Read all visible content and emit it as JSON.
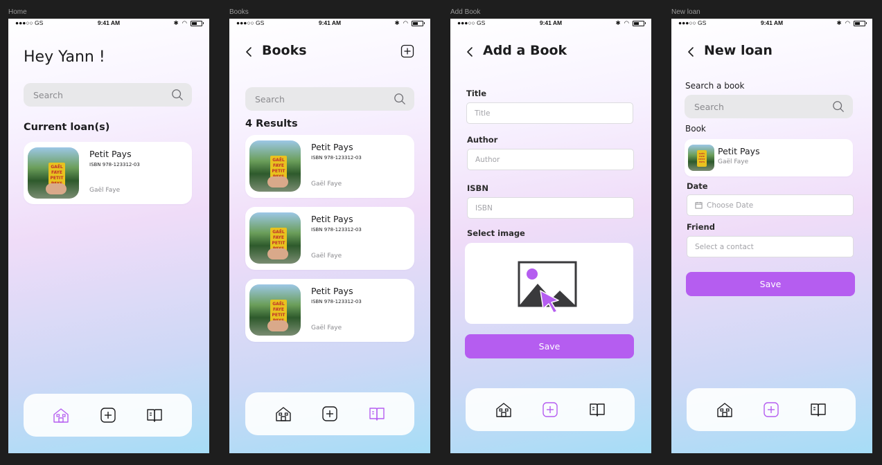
{
  "frames": [
    "Home",
    "Books",
    "Add Book",
    "New loan"
  ],
  "status": {
    "carrier": "●●●○○ GS",
    "time": "9:41 AM"
  },
  "home": {
    "greeting": "Hey Yann !",
    "search_placeholder": "Search",
    "section": "Current loan(s)",
    "loan": {
      "title": "Petit Pays",
      "isbn": "ISBN 978-123312-03",
      "author": "Gaël Faye"
    }
  },
  "books": {
    "title": "Books",
    "search_placeholder": "Search",
    "results": "4 Results",
    "items": [
      {
        "title": "Petit Pays",
        "isbn": "ISBN 978-123312-03",
        "author": "Gaël Faye"
      },
      {
        "title": "Petit Pays",
        "isbn": "ISBN 978-123312-03",
        "author": "Gaël Faye"
      },
      {
        "title": "Petit Pays",
        "isbn": "ISBN 978-123312-03",
        "author": "Gaël Faye"
      }
    ]
  },
  "add_book": {
    "title": "Add a Book",
    "title_label": "Title",
    "title_placeholder": "Title",
    "author_label": "Author",
    "author_placeholder": "Author",
    "isbn_label": "ISBN",
    "isbn_placeholder": "ISBN",
    "image_label": "Select image",
    "save": "Save"
  },
  "new_loan": {
    "title": "New loan",
    "search_label": "Search a book",
    "search_placeholder": "Search",
    "book_label": "Book",
    "book": {
      "title": "Petit Pays",
      "author": "Gaël Faye"
    },
    "date_label": "Date",
    "date_placeholder": "Choose Date",
    "friend_label": "Friend",
    "friend_placeholder": "Select a contact",
    "save": "Save"
  },
  "cover_text": {
    "top": "GAËL FAYE",
    "main": "PETIT PAYS"
  },
  "icons": [
    "home-icon",
    "add-icon",
    "book-icon",
    "search-icon",
    "back-icon",
    "image-picker-icon",
    "calendar-icon"
  ],
  "colors": {
    "accent": "#b55df0",
    "text": "#1c1c1e",
    "muted": "#8a8a8e"
  },
  "active_tab": {
    "Home": "home",
    "Books": "books",
    "Add Book": "add",
    "New loan": "add"
  }
}
